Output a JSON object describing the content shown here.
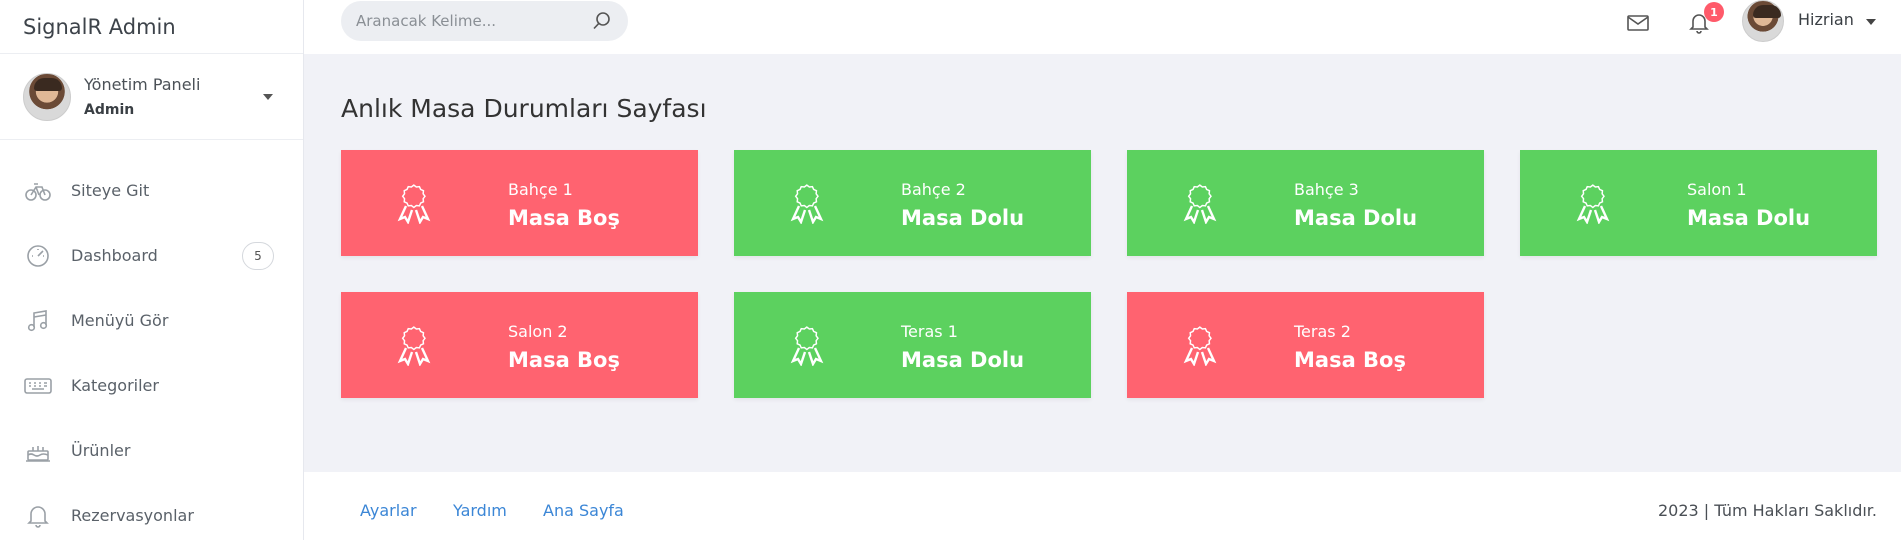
{
  "app": {
    "title": "SignalR Admin"
  },
  "profile": {
    "title": "Yönetim Paneli",
    "role": "Admin"
  },
  "sidebar": {
    "items": [
      {
        "label": "Siteye Git",
        "icon": "bicycle-icon"
      },
      {
        "label": "Dashboard",
        "icon": "gauge-icon",
        "badge": "5"
      },
      {
        "label": "Menüyü Gör",
        "icon": "music-note-icon"
      },
      {
        "label": "Kategoriler",
        "icon": "keyboard-icon"
      },
      {
        "label": "Ürünler",
        "icon": "cake-icon"
      },
      {
        "label": "Rezervasyonlar",
        "icon": "bell-icon"
      }
    ]
  },
  "header": {
    "search_placeholder": "Aranacak Kelime...",
    "notification_count": "1",
    "user_name": "Hizrian"
  },
  "main": {
    "title": "Anlık Masa Durumları Sayfası",
    "tables": [
      {
        "name": "Bahçe 1",
        "status": "Masa Boş"
      },
      {
        "name": "Bahçe 2",
        "status": "Masa Dolu"
      },
      {
        "name": "Bahçe 3",
        "status": "Masa Dolu"
      },
      {
        "name": "Salon 1",
        "status": "Masa Dolu"
      },
      {
        "name": "Salon 2",
        "status": "Masa Boş"
      },
      {
        "name": "Teras 1",
        "status": "Masa Dolu"
      },
      {
        "name": "Teras 2",
        "status": "Masa Boş"
      }
    ]
  },
  "footer": {
    "links": [
      "Ayarlar",
      "Yardım",
      "Ana Sayfa"
    ],
    "copyright": "2023 | Tüm Hakları Saklıdır."
  },
  "colors": {
    "empty": "#ff6370",
    "full": "#5cd15f",
    "link": "#3b86d6",
    "badge": "#ff5a6a"
  }
}
